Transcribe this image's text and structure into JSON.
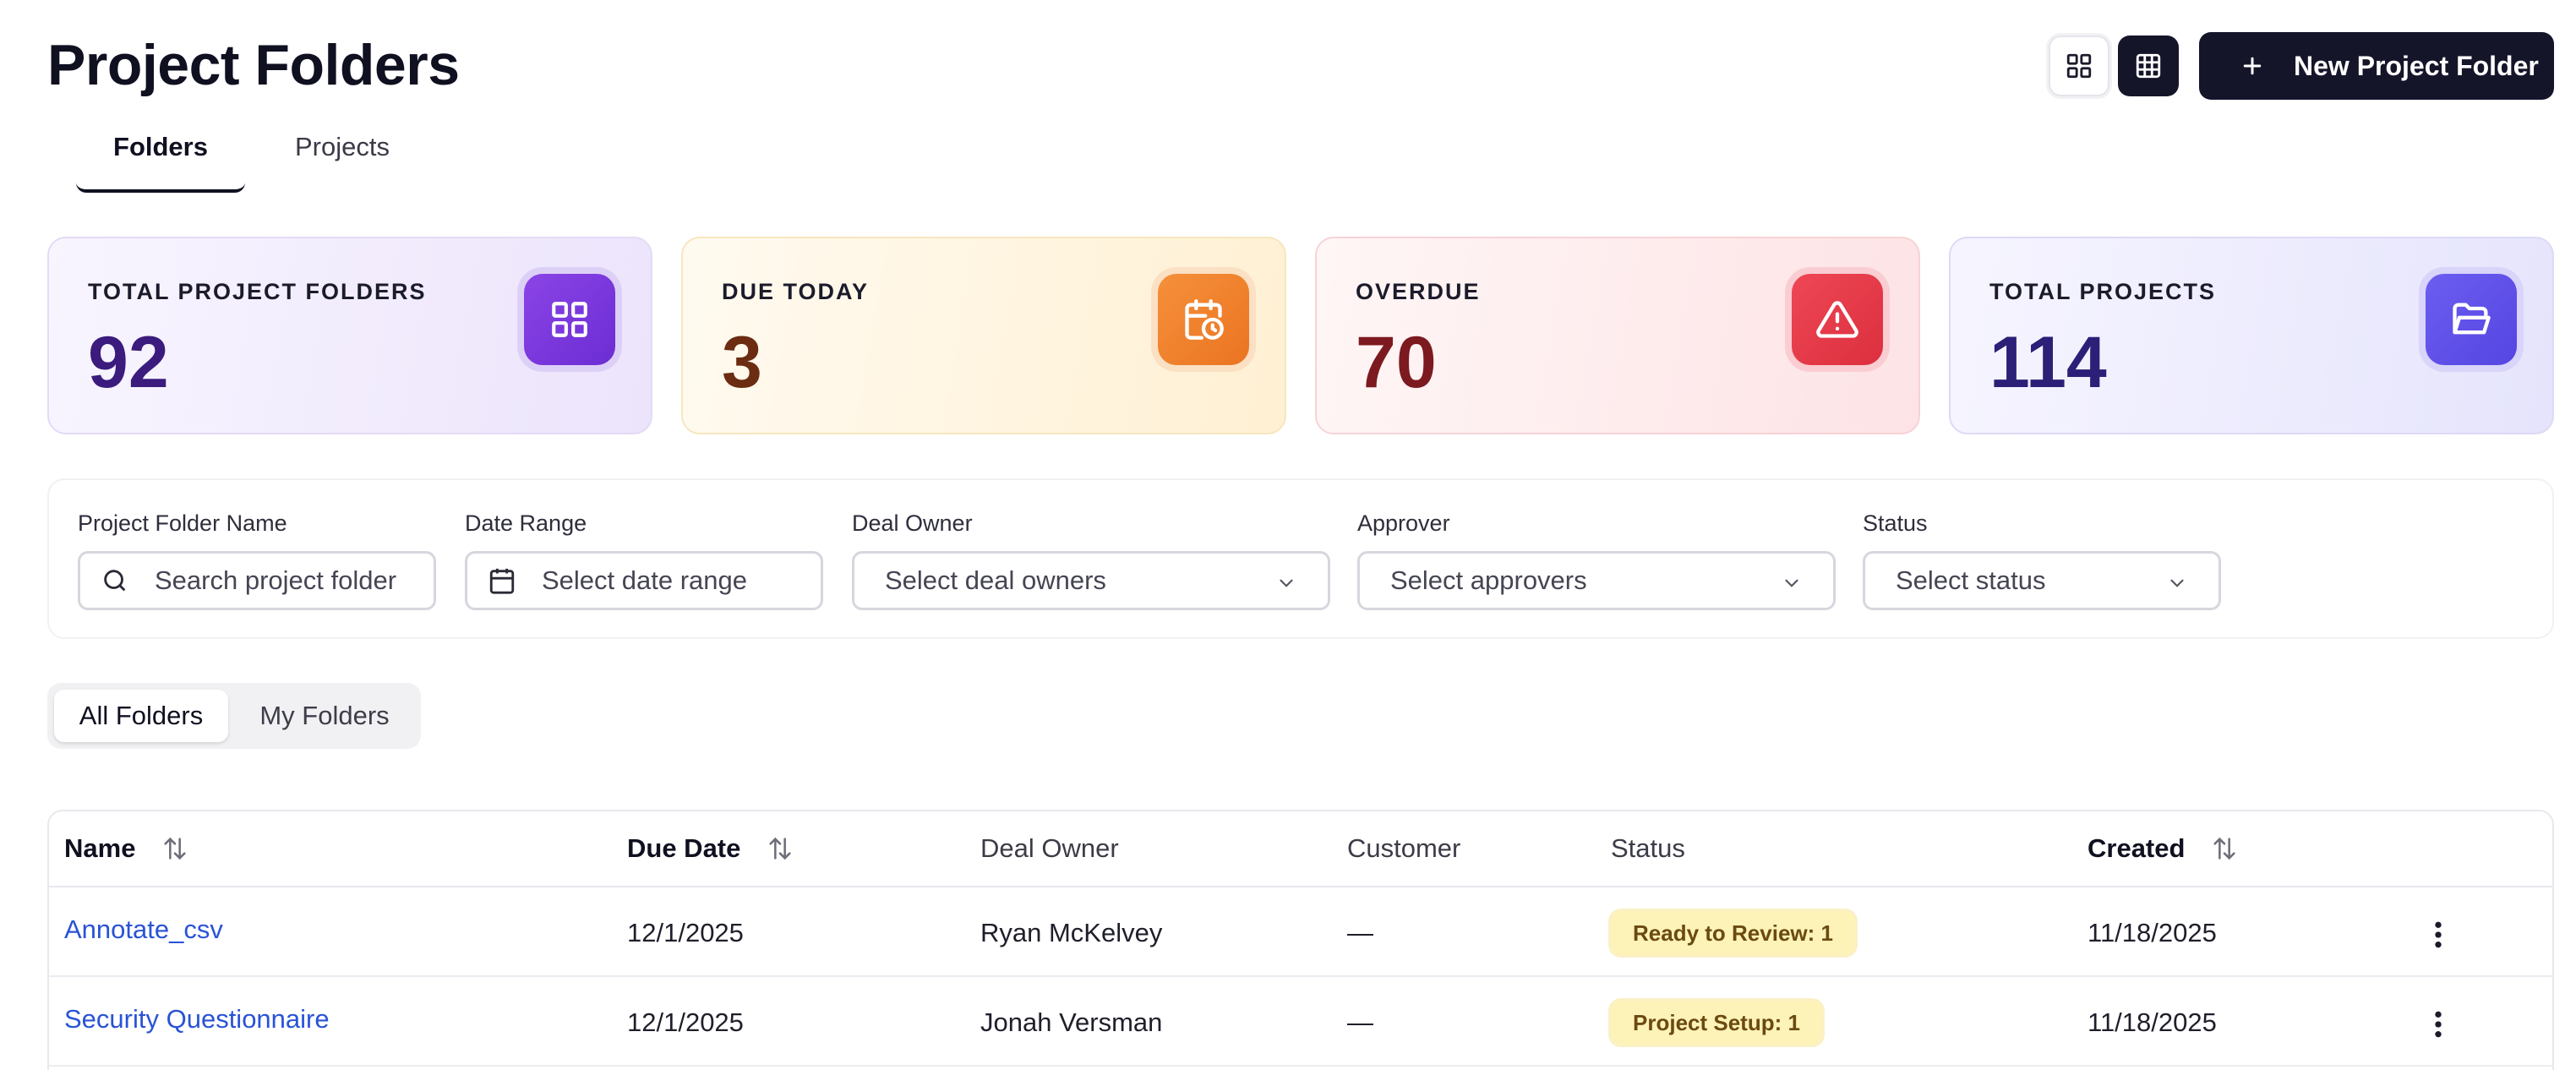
{
  "header": {
    "title": "Project Folders",
    "new_button_label": "New Project Folder"
  },
  "tabs": [
    {
      "label": "Folders",
      "active": true
    },
    {
      "label": "Projects",
      "active": false
    }
  ],
  "stats": [
    {
      "label": "TOTAL PROJECT FOLDERS",
      "value": "92",
      "icon": "grid-icon"
    },
    {
      "label": "DUE TODAY",
      "value": "3",
      "icon": "calendar-clock-icon"
    },
    {
      "label": "OVERDUE",
      "value": "70",
      "icon": "warning-icon"
    },
    {
      "label": "TOTAL PROJECTS",
      "value": "114",
      "icon": "folder-open-icon"
    }
  ],
  "filters": {
    "name": {
      "label": "Project Folder Name",
      "placeholder": "Search project folder"
    },
    "date_range": {
      "label": "Date Range",
      "placeholder": "Select date range"
    },
    "deal_owner": {
      "label": "Deal Owner",
      "placeholder": "Select deal owners"
    },
    "approver": {
      "label": "Approver",
      "placeholder": "Select approvers"
    },
    "status": {
      "label": "Status",
      "placeholder": "Select status"
    }
  },
  "folder_filter": {
    "all_label": "All Folders",
    "mine_label": "My Folders",
    "selected": "All Folders"
  },
  "table": {
    "columns": {
      "name": "Name",
      "due_date": "Due Date",
      "deal_owner": "Deal Owner",
      "customer": "Customer",
      "status": "Status",
      "created": "Created"
    },
    "rows": [
      {
        "name": "Annotate_csv",
        "due_date": "12/1/2025",
        "deal_owner": "Ryan McKelvey",
        "customer": "—",
        "status": "Ready to Review: 1",
        "created": "11/18/2025"
      },
      {
        "name": "Security Questionnaire",
        "due_date": "12/1/2025",
        "deal_owner": "Jonah Versman",
        "customer": "—",
        "status": "Project Setup: 1",
        "created": "11/18/2025"
      }
    ]
  },
  "colors": {
    "primary_dark": "#15152a",
    "link": "#2953d6",
    "badge_bg": "#fdf3b8"
  }
}
